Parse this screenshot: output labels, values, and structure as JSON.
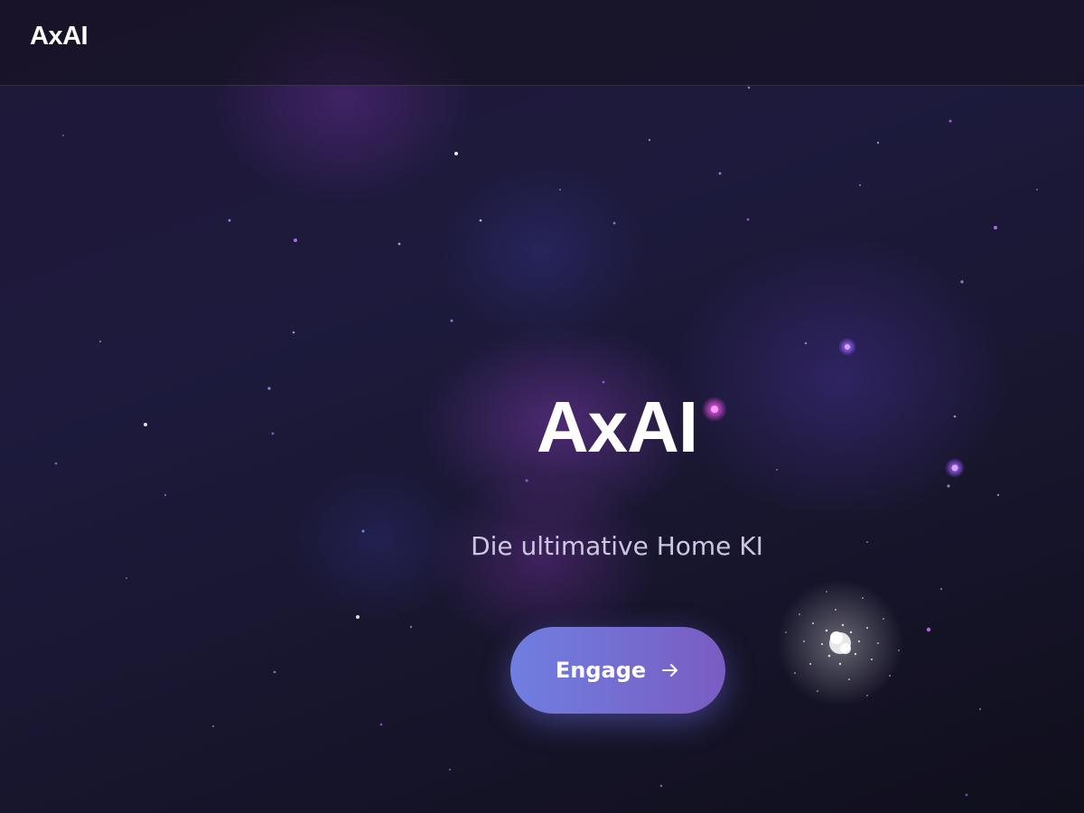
{
  "header": {
    "logo_text": "AxAI"
  },
  "hero": {
    "title": "AxAI",
    "subtitle": "Die ultimative Home KI",
    "cta_label": "Engage",
    "cta_icon": "arrow-right-icon"
  },
  "colors": {
    "background": "#1d1a3d",
    "button_start": "#6f7fe0",
    "button_end": "#7a5cc2",
    "text_primary": "#ffffff",
    "text_secondary": "#cdc6e2"
  }
}
